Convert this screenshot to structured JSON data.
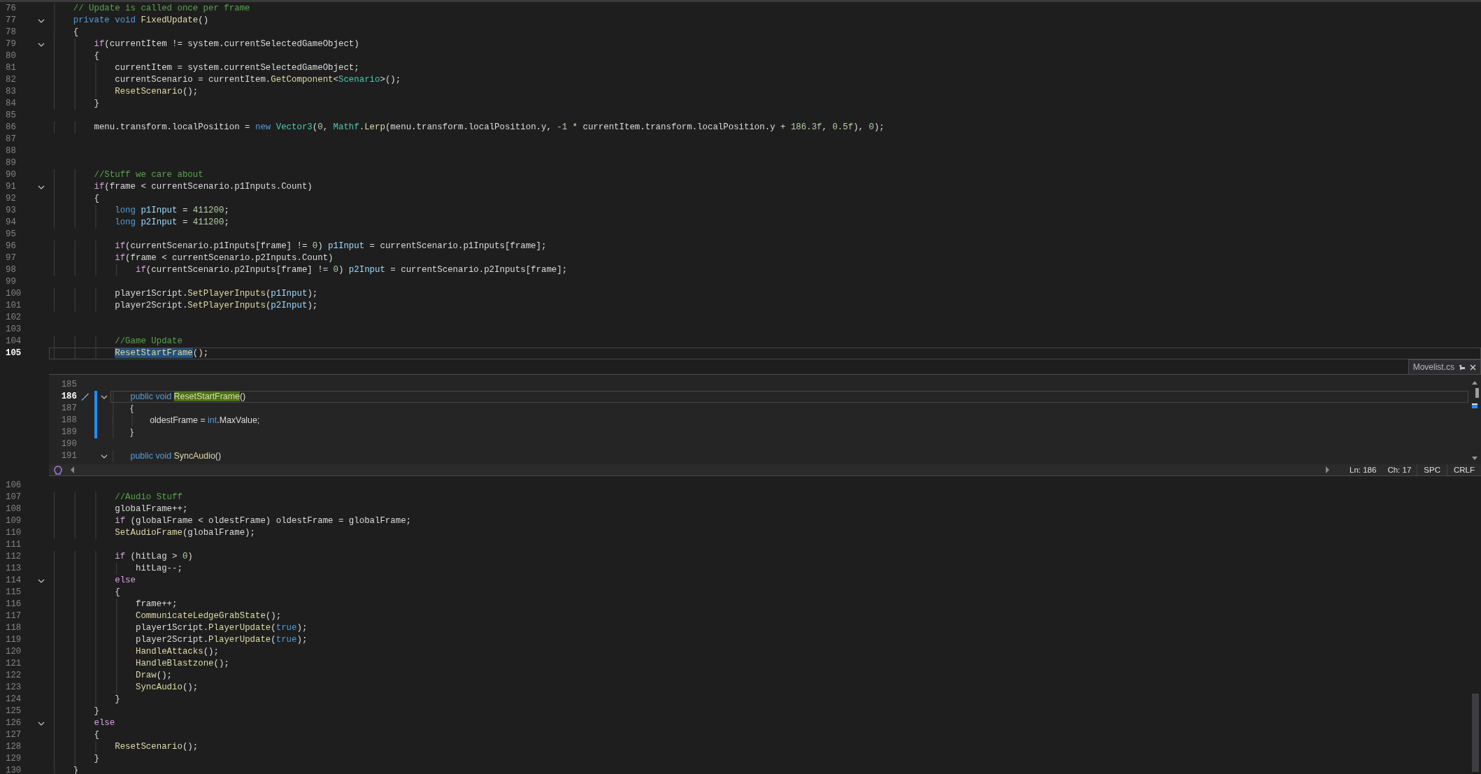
{
  "top_pane": {
    "lines": [
      {
        "number": "76",
        "fold": false,
        "current": false,
        "tokens": [
          {
            "kind": "comment",
            "text": "    // Update is called once per frame"
          }
        ]
      },
      {
        "number": "77",
        "fold": true,
        "current": false,
        "tokens": [
          {
            "kind": "keyword",
            "text": "    private void "
          },
          {
            "kind": "method",
            "text": "FixedUpdate"
          },
          {
            "kind": "plain",
            "text": "()"
          }
        ]
      },
      {
        "number": "78",
        "fold": false,
        "current": false,
        "tokens": [
          {
            "kind": "plain",
            "text": "    {"
          }
        ]
      },
      {
        "number": "79",
        "fold": true,
        "current": false,
        "tokens": [
          {
            "kind": "control",
            "text": "        if"
          },
          {
            "kind": "plain",
            "text": "(currentItem != system.currentSelectedGameObject)"
          }
        ]
      },
      {
        "number": "80",
        "fold": false,
        "current": false,
        "tokens": [
          {
            "kind": "plain",
            "text": "        {"
          }
        ]
      },
      {
        "number": "81",
        "fold": false,
        "current": false,
        "tokens": [
          {
            "kind": "plain",
            "text": "            currentItem = system.currentSelectedGameObject;"
          }
        ]
      },
      {
        "number": "82",
        "fold": false,
        "current": false,
        "tokens": [
          {
            "kind": "plain",
            "text": "            currentScenario = currentItem."
          },
          {
            "kind": "method",
            "text": "GetComponent"
          },
          {
            "kind": "plain",
            "text": "<"
          },
          {
            "kind": "type",
            "text": "Scenario"
          },
          {
            "kind": "plain",
            "text": ">();"
          }
        ]
      },
      {
        "number": "83",
        "fold": false,
        "current": false,
        "tokens": [
          {
            "kind": "method",
            "text": "            ResetScenario"
          },
          {
            "kind": "plain",
            "text": "();"
          }
        ]
      },
      {
        "number": "84",
        "fold": false,
        "current": false,
        "tokens": [
          {
            "kind": "plain",
            "text": "        }"
          }
        ]
      },
      {
        "number": "85",
        "fold": false,
        "current": false
      },
      {
        "number": "86",
        "fold": false,
        "current": false,
        "tokens": [
          {
            "kind": "plain",
            "text": "        menu.transform.localPosition = "
          },
          {
            "kind": "keyword",
            "text": "new "
          },
          {
            "kind": "type",
            "text": "Vector3"
          },
          {
            "kind": "plain",
            "text": "("
          },
          {
            "kind": "number",
            "text": "0"
          },
          {
            "kind": "plain",
            "text": ", "
          },
          {
            "kind": "type",
            "text": "Mathf"
          },
          {
            "kind": "plain",
            "text": "."
          },
          {
            "kind": "method",
            "text": "Lerp"
          },
          {
            "kind": "plain",
            "text": "(menu.transform.localPosition.y, "
          },
          {
            "kind": "number",
            "text": "-1"
          },
          {
            "kind": "plain",
            "text": " * currentItem.transform.localPosition.y + "
          },
          {
            "kind": "number",
            "text": "186.3f"
          },
          {
            "kind": "plain",
            "text": ", "
          },
          {
            "kind": "number",
            "text": "0.5f"
          },
          {
            "kind": "plain",
            "text": "), "
          },
          {
            "kind": "number",
            "text": "0"
          },
          {
            "kind": "plain",
            "text": ");"
          }
        ]
      },
      {
        "number": "87",
        "fold": false,
        "current": false
      },
      {
        "number": "88",
        "fold": false,
        "current": false
      },
      {
        "number": "89",
        "fold": false,
        "current": false
      },
      {
        "number": "90",
        "fold": false,
        "current": false,
        "tokens": [
          {
            "kind": "comment",
            "text": "        //Stuff we care about"
          }
        ]
      },
      {
        "number": "91",
        "fold": true,
        "current": false,
        "tokens": [
          {
            "kind": "control",
            "text": "        if"
          },
          {
            "kind": "plain",
            "text": "(frame < currentScenario.p1Inputs.Count)"
          }
        ]
      },
      {
        "number": "92",
        "fold": false,
        "current": false,
        "tokens": [
          {
            "kind": "plain",
            "text": "        {"
          }
        ]
      },
      {
        "number": "93",
        "fold": false,
        "current": false,
        "tokens": [
          {
            "kind": "keyword",
            "text": "            long "
          },
          {
            "kind": "local",
            "text": "p1Input"
          },
          {
            "kind": "plain",
            "text": " = "
          },
          {
            "kind": "number",
            "text": "411200"
          },
          {
            "kind": "plain",
            "text": ";"
          }
        ]
      },
      {
        "number": "94",
        "fold": false,
        "current": false,
        "tokens": [
          {
            "kind": "keyword",
            "text": "            long "
          },
          {
            "kind": "local",
            "text": "p2Input"
          },
          {
            "kind": "plain",
            "text": " = "
          },
          {
            "kind": "number",
            "text": "411200"
          },
          {
            "kind": "plain",
            "text": ";"
          }
        ]
      },
      {
        "number": "95",
        "fold": false,
        "current": false
      },
      {
        "number": "96",
        "fold": false,
        "current": false,
        "tokens": [
          {
            "kind": "control",
            "text": "            if"
          },
          {
            "kind": "plain",
            "text": "(currentScenario.p1Inputs[frame] != "
          },
          {
            "kind": "number",
            "text": "0"
          },
          {
            "kind": "plain",
            "text": ") "
          },
          {
            "kind": "local",
            "text": "p1Input"
          },
          {
            "kind": "plain",
            "text": " = currentScenario.p1Inputs[frame];"
          }
        ]
      },
      {
        "number": "97",
        "fold": false,
        "current": false,
        "tokens": [
          {
            "kind": "control",
            "text": "            if"
          },
          {
            "kind": "plain",
            "text": "(frame < currentScenario.p2Inputs.Count)"
          }
        ]
      },
      {
        "number": "98",
        "fold": false,
        "current": false,
        "tokens": [
          {
            "kind": "control",
            "text": "                if"
          },
          {
            "kind": "plain",
            "text": "(currentScenario.p2Inputs[frame] != "
          },
          {
            "kind": "number",
            "text": "0"
          },
          {
            "kind": "plain",
            "text": ") "
          },
          {
            "kind": "local",
            "text": "p2Input"
          },
          {
            "kind": "plain",
            "text": " = currentScenario.p2Inputs[frame];"
          }
        ]
      },
      {
        "number": "99",
        "fold": false,
        "current": false
      },
      {
        "number": "100",
        "fold": false,
        "current": false,
        "tokens": [
          {
            "kind": "plain",
            "text": "            player1Script."
          },
          {
            "kind": "method",
            "text": "SetPlayerInputs"
          },
          {
            "kind": "plain",
            "text": "("
          },
          {
            "kind": "local",
            "text": "p1Input"
          },
          {
            "kind": "plain",
            "text": ");"
          }
        ]
      },
      {
        "number": "101",
        "fold": false,
        "current": false,
        "tokens": [
          {
            "kind": "plain",
            "text": "            player2Script."
          },
          {
            "kind": "method",
            "text": "SetPlayerInputs"
          },
          {
            "kind": "plain",
            "text": "("
          },
          {
            "kind": "local",
            "text": "p2Input"
          },
          {
            "kind": "plain",
            "text": ");"
          }
        ]
      },
      {
        "number": "102",
        "fold": false,
        "current": false
      },
      {
        "number": "103",
        "fold": false,
        "current": false
      },
      {
        "number": "104",
        "fold": false,
        "current": false,
        "tokens": [
          {
            "kind": "comment",
            "text": "            //Game Update"
          }
        ]
      },
      {
        "number": "105",
        "fold": false,
        "current": true,
        "tokens": [
          {
            "kind": "selection",
            "text": "            ResetStartFrame"
          },
          {
            "kind": "plain",
            "text": "();"
          }
        ]
      }
    ]
  },
  "peek": {
    "tab": {
      "title": "Movelist.cs"
    },
    "lines": [
      {
        "number": "185",
        "fold": false,
        "current": false,
        "changed": false
      },
      {
        "number": "186",
        "fold": true,
        "current": true,
        "changed": true,
        "tokens": [
          {
            "kind": "keyword",
            "text": "    public void "
          },
          {
            "kind": "match",
            "text": "ResetStartFrame"
          },
          {
            "kind": "plain",
            "text": "()"
          }
        ]
      },
      {
        "number": "187",
        "fold": false,
        "current": false,
        "changed": true,
        "tokens": [
          {
            "kind": "plain",
            "text": "    {"
          }
        ]
      },
      {
        "number": "188",
        "fold": false,
        "current": false,
        "changed": true,
        "tokens": [
          {
            "kind": "plain",
            "text": "        oldestFrame = "
          },
          {
            "kind": "keyword",
            "text": "int"
          },
          {
            "kind": "plain",
            "text": ".MaxValue;"
          }
        ]
      },
      {
        "number": "189",
        "fold": false,
        "current": false,
        "changed": true,
        "tokens": [
          {
            "kind": "plain",
            "text": "    }"
          }
        ]
      },
      {
        "number": "190",
        "fold": false,
        "current": false,
        "changed": false
      },
      {
        "number": "191",
        "fold": true,
        "current": false,
        "changed": false,
        "tokens": [
          {
            "kind": "keyword",
            "text": "    public void "
          },
          {
            "kind": "method",
            "text": "SyncAudio"
          },
          {
            "kind": "plain",
            "text": "()"
          }
        ]
      }
    ],
    "status": {
      "line": "Ln: 186",
      "column": "Ch: 17",
      "indent": "SPC",
      "line_ending": "CRLF"
    }
  },
  "bottom_pane": {
    "lines": [
      {
        "number": "106",
        "fold": false,
        "current": false
      },
      {
        "number": "107",
        "fold": false,
        "current": false,
        "tokens": [
          {
            "kind": "comment",
            "text": "            //Audio Stuff"
          }
        ]
      },
      {
        "number": "108",
        "fold": false,
        "current": false,
        "tokens": [
          {
            "kind": "plain",
            "text": "            globalFrame++;"
          }
        ]
      },
      {
        "number": "109",
        "fold": false,
        "current": false,
        "tokens": [
          {
            "kind": "control",
            "text": "            if"
          },
          {
            "kind": "plain",
            "text": " (globalFrame < oldestFrame) oldestFrame = globalFrame;"
          }
        ]
      },
      {
        "number": "110",
        "fold": false,
        "current": false,
        "tokens": [
          {
            "kind": "method",
            "text": "            SetAudioFrame"
          },
          {
            "kind": "plain",
            "text": "(globalFrame);"
          }
        ]
      },
      {
        "number": "111",
        "fold": false,
        "current": false
      },
      {
        "number": "112",
        "fold": false,
        "current": false,
        "tokens": [
          {
            "kind": "control",
            "text": "            if"
          },
          {
            "kind": "plain",
            "text": " (hitLag > "
          },
          {
            "kind": "number",
            "text": "0"
          },
          {
            "kind": "plain",
            "text": ")"
          }
        ]
      },
      {
        "number": "113",
        "fold": false,
        "current": false,
        "tokens": [
          {
            "kind": "plain",
            "text": "                hitLag--;"
          }
        ]
      },
      {
        "number": "114",
        "fold": true,
        "current": false,
        "tokens": [
          {
            "kind": "control",
            "text": "            else"
          }
        ]
      },
      {
        "number": "115",
        "fold": false,
        "current": false,
        "tokens": [
          {
            "kind": "plain",
            "text": "            {"
          }
        ]
      },
      {
        "number": "116",
        "fold": false,
        "current": false,
        "tokens": [
          {
            "kind": "plain",
            "text": "                frame++;"
          }
        ]
      },
      {
        "number": "117",
        "fold": false,
        "current": false,
        "tokens": [
          {
            "kind": "method",
            "text": "                CommunicateLedgeGrabState"
          },
          {
            "kind": "plain",
            "text": "();"
          }
        ]
      },
      {
        "number": "118",
        "fold": false,
        "current": false,
        "tokens": [
          {
            "kind": "plain",
            "text": "                player1Script."
          },
          {
            "kind": "method",
            "text": "PlayerUpdate"
          },
          {
            "kind": "plain",
            "text": "("
          },
          {
            "kind": "keyword",
            "text": "true"
          },
          {
            "kind": "plain",
            "text": ");"
          }
        ]
      },
      {
        "number": "119",
        "fold": false,
        "current": false,
        "tokens": [
          {
            "kind": "plain",
            "text": "                player2Script."
          },
          {
            "kind": "method",
            "text": "PlayerUpdate"
          },
          {
            "kind": "plain",
            "text": "("
          },
          {
            "kind": "keyword",
            "text": "true"
          },
          {
            "kind": "plain",
            "text": ");"
          }
        ]
      },
      {
        "number": "120",
        "fold": false,
        "current": false,
        "tokens": [
          {
            "kind": "method",
            "text": "                HandleAttacks"
          },
          {
            "kind": "plain",
            "text": "();"
          }
        ]
      },
      {
        "number": "121",
        "fold": false,
        "current": false,
        "tokens": [
          {
            "kind": "method",
            "text": "                HandleBlastzone"
          },
          {
            "kind": "plain",
            "text": "();"
          }
        ]
      },
      {
        "number": "122",
        "fold": false,
        "current": false,
        "tokens": [
          {
            "kind": "method",
            "text": "                Draw"
          },
          {
            "kind": "plain",
            "text": "();"
          }
        ]
      },
      {
        "number": "123",
        "fold": false,
        "current": false,
        "tokens": [
          {
            "kind": "method",
            "text": "                SyncAudio"
          },
          {
            "kind": "plain",
            "text": "();"
          }
        ]
      },
      {
        "number": "124",
        "fold": false,
        "current": false,
        "tokens": [
          {
            "kind": "plain",
            "text": "            }"
          }
        ]
      },
      {
        "number": "125",
        "fold": false,
        "current": false,
        "tokens": [
          {
            "kind": "plain",
            "text": "        }"
          }
        ]
      },
      {
        "number": "126",
        "fold": true,
        "current": false,
        "tokens": [
          {
            "kind": "control",
            "text": "        else"
          }
        ]
      },
      {
        "number": "127",
        "fold": false,
        "current": false,
        "tokens": [
          {
            "kind": "plain",
            "text": "        {"
          }
        ]
      },
      {
        "number": "128",
        "fold": false,
        "current": false,
        "tokens": [
          {
            "kind": "method",
            "text": "            ResetScenario"
          },
          {
            "kind": "plain",
            "text": "();"
          }
        ]
      },
      {
        "number": "129",
        "fold": false,
        "current": false,
        "tokens": [
          {
            "kind": "plain",
            "text": "        }"
          }
        ]
      },
      {
        "number": "130",
        "fold": false,
        "current": false,
        "tokens": [
          {
            "kind": "plain",
            "text": "    }"
          }
        ]
      }
    ]
  }
}
